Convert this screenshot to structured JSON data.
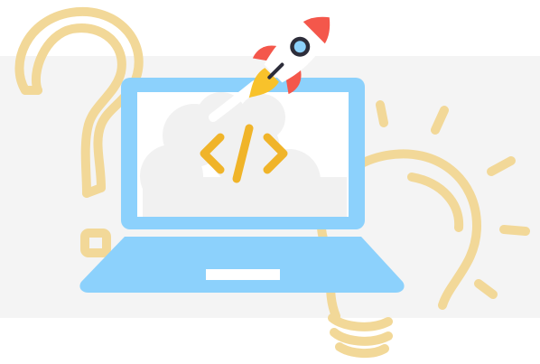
{
  "illustration": {
    "background_color": "#ffffff",
    "band_color": "#f4f4f4",
    "outline_color": "#f2d898",
    "laptop_color": "#8cd1fc",
    "screen_color": "#ffffff",
    "cloud_color": "#f1f1f1",
    "code_symbol_color": "#f0b429",
    "rocket_colors": {
      "body": "#ffffff",
      "fins": "#f4574b",
      "window_ring": "#2d2d3a",
      "window_glass": "#8cd1fc",
      "flame": "#f8c22b"
    },
    "icons": [
      "question-mark-icon",
      "lightbulb-icon",
      "laptop-icon",
      "code-brackets-icon",
      "rocket-icon",
      "cloud-icon"
    ]
  }
}
